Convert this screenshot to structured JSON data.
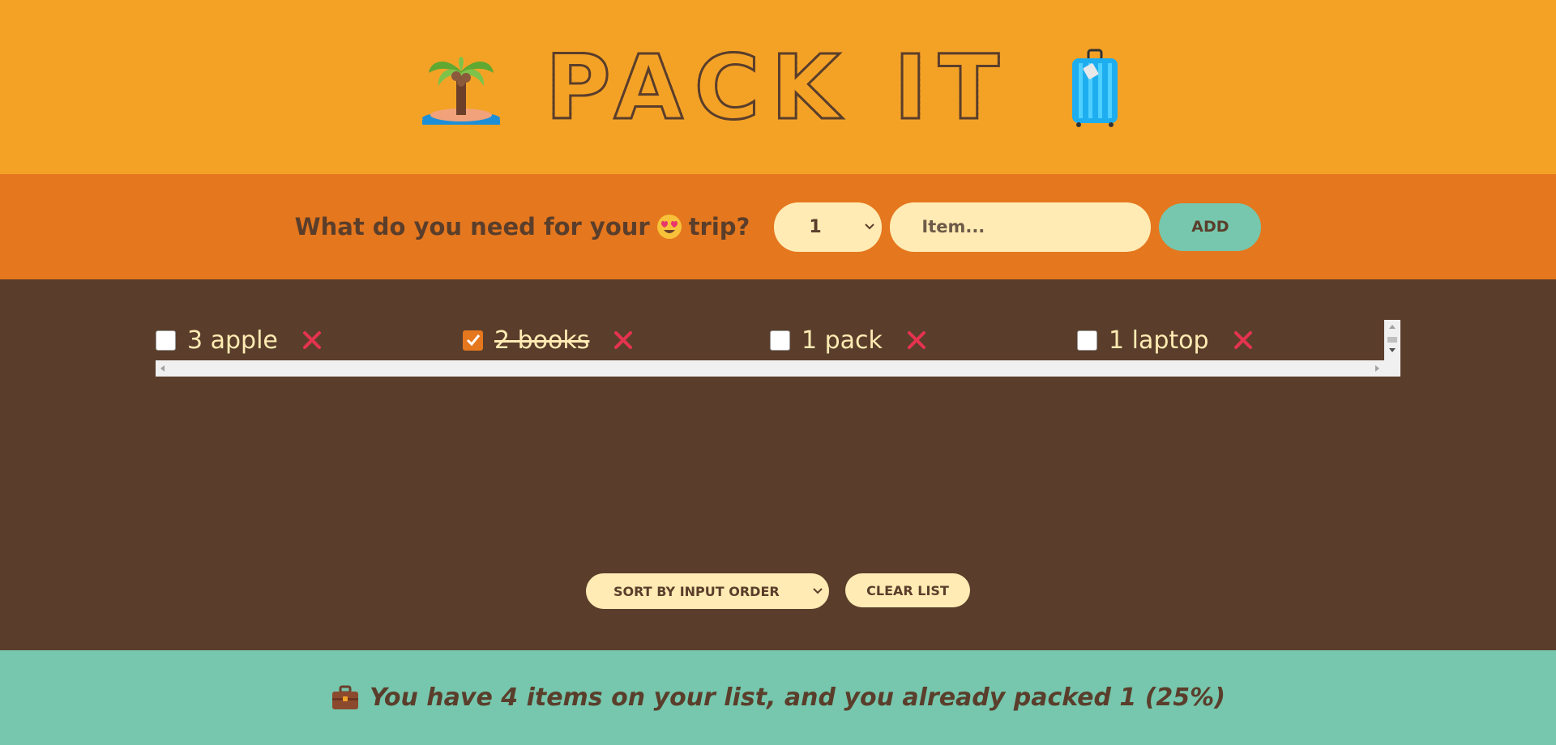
{
  "header": {
    "title": "PACK IT",
    "left_icon": "palm-island-icon",
    "right_icon": "suitcase-icon"
  },
  "form": {
    "question_prefix": "What do you need for your",
    "question_emoji": "heart-eyes-icon",
    "question_suffix": "trip?",
    "quantity_value": "1",
    "item_placeholder": "Item...",
    "add_label": "ADD"
  },
  "list": {
    "items": [
      {
        "text": "3 apple",
        "packed": false
      },
      {
        "text": "2 books",
        "packed": true
      },
      {
        "text": "1 pack",
        "packed": false
      },
      {
        "text": "1 laptop",
        "packed": false
      }
    ]
  },
  "actions": {
    "sort_value": "SORT BY INPUT ORDER",
    "clear_label": "CLEAR LIST"
  },
  "stats": {
    "icon": "briefcase-icon",
    "text": "You have 4 items on your list, and you already packed 1 (25%)"
  },
  "colors": {
    "header_bg": "#f4a226",
    "form_bg": "#e5771e",
    "list_bg": "#5a3e2b",
    "stats_bg": "#76c7ad",
    "cream": "#ffebb3",
    "delete_red": "#e5334f"
  }
}
